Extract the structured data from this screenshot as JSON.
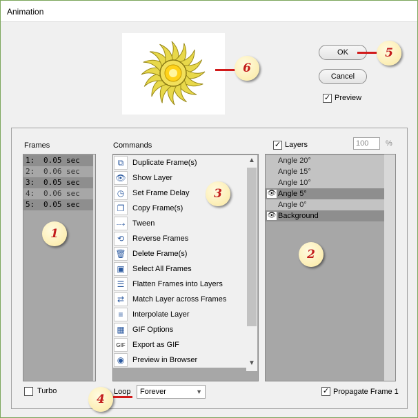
{
  "window": {
    "title": "Animation"
  },
  "buttons": {
    "ok": "OK",
    "cancel": "Cancel"
  },
  "preview": {
    "label": "Preview",
    "checked": true
  },
  "frames": {
    "header": "Frames",
    "unit": "sec",
    "items": [
      {
        "index": "1:",
        "duration": "0.05"
      },
      {
        "index": "2:",
        "duration": "0.06"
      },
      {
        "index": "3:",
        "duration": "0.05"
      },
      {
        "index": "4:",
        "duration": "0.06"
      },
      {
        "index": "5:",
        "duration": "0.05"
      }
    ]
  },
  "commands": {
    "header": "Commands",
    "items": [
      {
        "label": "Duplicate Frame(s)",
        "icon": "duplicate-frame-icon"
      },
      {
        "label": "Show Layer",
        "icon": "eye-icon"
      },
      {
        "label": "Set Frame Delay",
        "icon": "clock-icon"
      },
      {
        "label": "Copy Frame(s)",
        "icon": "copy-frames-icon"
      },
      {
        "label": "Tween",
        "icon": "tween-icon"
      },
      {
        "label": "Reverse Frames",
        "icon": "reverse-icon"
      },
      {
        "label": "Delete Frame(s)",
        "icon": "trash-icon"
      },
      {
        "label": "Select All Frames",
        "icon": "select-all-icon"
      },
      {
        "label": "Flatten Frames into Layers",
        "icon": "flatten-icon"
      },
      {
        "label": "Match Layer across Frames",
        "icon": "match-layer-icon"
      },
      {
        "label": "Interpolate Layer",
        "icon": "interpolate-icon"
      },
      {
        "label": "GIF Options",
        "icon": "gif-options-icon"
      },
      {
        "label": "Export as GIF",
        "icon": "gif-export-icon"
      },
      {
        "label": "Preview in Browser",
        "icon": "browser-icon"
      }
    ]
  },
  "layers": {
    "label": "Layers",
    "checked": true,
    "opacity": "100",
    "opacity_unit": "%",
    "items": [
      {
        "name": "Angle 20°",
        "visible": false
      },
      {
        "name": "Angle 15°",
        "visible": false
      },
      {
        "name": "Angle 10°",
        "visible": false
      },
      {
        "name": "Angle 5°",
        "visible": true
      },
      {
        "name": "Angle 0°",
        "visible": false
      },
      {
        "name": "Background",
        "visible": true
      }
    ]
  },
  "options": {
    "turbo_label": "Turbo",
    "turbo_checked": false,
    "loop_label": "Loop",
    "loop_value": "Forever",
    "propagate_label": "Propagate Frame 1",
    "propagate_checked": true
  },
  "callouts": [
    "1",
    "2",
    "3",
    "4",
    "5",
    "6"
  ],
  "colors": {
    "badge_text": "#c31d1d",
    "callout_line": "#d11a1a",
    "list_bg": "#a7a7a7",
    "row_highlight": "#8e8e8e"
  }
}
